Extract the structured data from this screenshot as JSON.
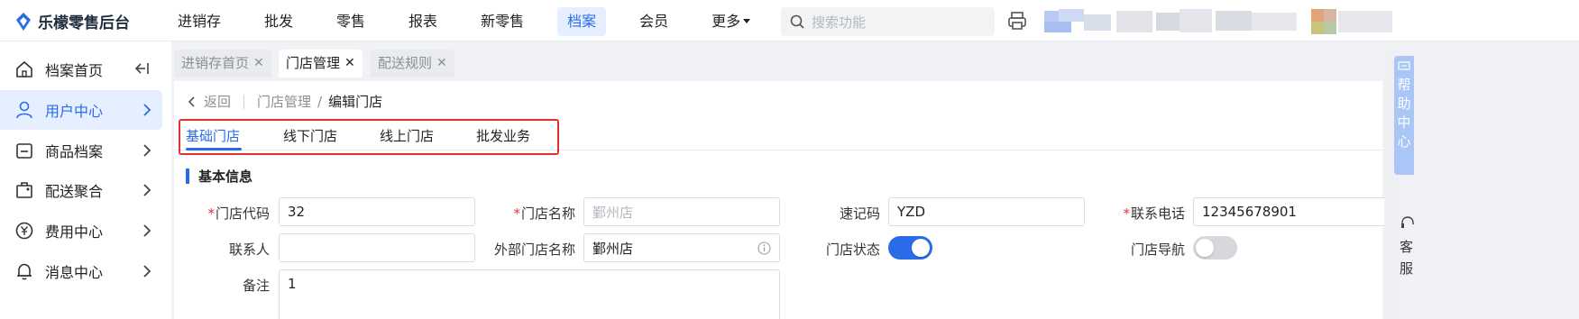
{
  "app": {
    "title": "乐檬零售后台"
  },
  "colors": {
    "accent": "#2a6ce8",
    "required": "#e03131",
    "highlight_box": "#e03131"
  },
  "nav": {
    "items": [
      {
        "label": "进销存",
        "active": false
      },
      {
        "label": "批发",
        "active": false
      },
      {
        "label": "零售",
        "active": false
      },
      {
        "label": "报表",
        "active": false
      },
      {
        "label": "新零售",
        "active": false
      },
      {
        "label": "档案",
        "active": true
      },
      {
        "label": "会员",
        "active": false
      },
      {
        "label": "更多",
        "active": false
      }
    ],
    "search_placeholder": "搜索功能"
  },
  "sidebar": {
    "items": [
      {
        "label": "档案首页",
        "icon": "home-icon"
      },
      {
        "label": "用户中心",
        "icon": "user-icon"
      },
      {
        "label": "商品档案",
        "icon": "product-icon"
      },
      {
        "label": "配送聚合",
        "icon": "package-icon"
      },
      {
        "label": "费用中心",
        "icon": "yen-icon"
      },
      {
        "label": "消息中心",
        "icon": "bell-icon"
      }
    ]
  },
  "page_tabs": [
    {
      "label": "进销存首页",
      "active": false
    },
    {
      "label": "门店管理",
      "active": true
    },
    {
      "label": "配送规则",
      "active": false
    }
  ],
  "breadcrumb": {
    "back": "返回",
    "parent": "门店管理",
    "separator": "/",
    "current": "编辑门店"
  },
  "sub_tabs": [
    {
      "label": "基础门店",
      "active": true
    },
    {
      "label": "线下门店",
      "active": false
    },
    {
      "label": "线上门店",
      "active": false
    },
    {
      "label": "批发业务",
      "active": false
    }
  ],
  "section": {
    "title": "基本信息"
  },
  "form": {
    "required_mark": "*",
    "store_code": {
      "label": "门店代码",
      "value": "32"
    },
    "store_name": {
      "label": "门店名称",
      "placeholder": "鄞州店"
    },
    "quick_code": {
      "label": "速记码",
      "value": "YZD"
    },
    "phone": {
      "label": "联系电话",
      "value": "12345678901"
    },
    "contact": {
      "label": "联系人",
      "value": ""
    },
    "external_name": {
      "label": "外部门店名称",
      "value": "鄞州店"
    },
    "store_status": {
      "label": "门店状态",
      "on": true
    },
    "store_nav": {
      "label": "门店导航",
      "on": false
    },
    "remark": {
      "label": "备注",
      "value": "1"
    }
  },
  "help": {
    "label_chars": [
      "帮",
      "助",
      "中",
      "心"
    ],
    "service_chars": [
      "客",
      "服"
    ]
  }
}
